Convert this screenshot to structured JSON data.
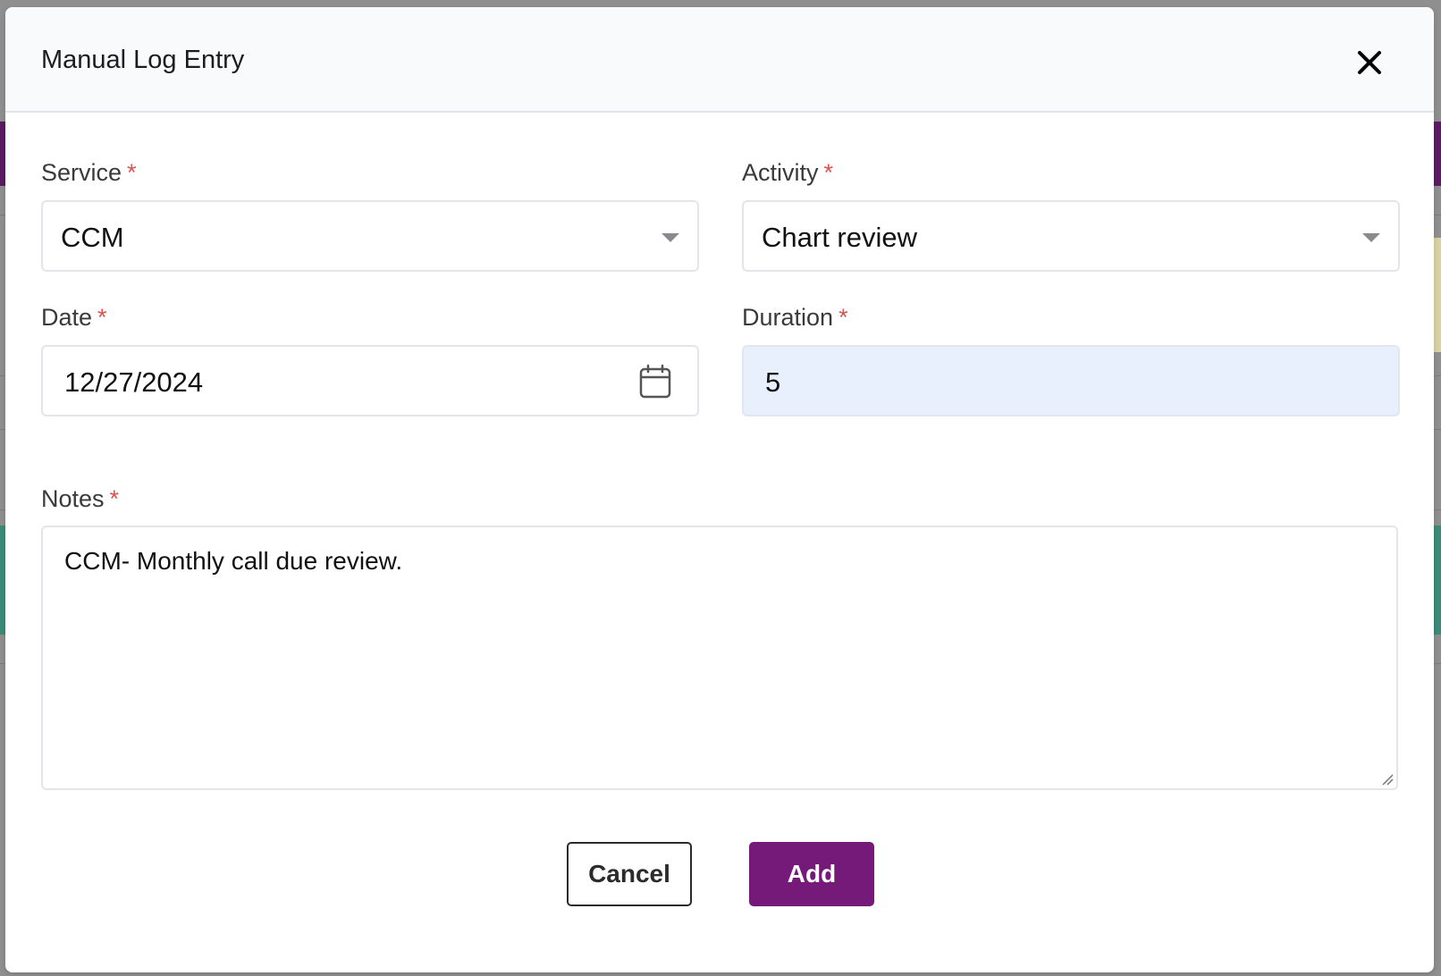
{
  "modal": {
    "title": "Manual Log Entry",
    "close_icon": "close-icon"
  },
  "form": {
    "service": {
      "label": "Service",
      "required_mark": "*",
      "value": "CCM"
    },
    "activity": {
      "label": "Activity",
      "required_mark": "*",
      "value": "Chart review"
    },
    "date": {
      "label": "Date",
      "required_mark": "*",
      "value": "12/27/2024",
      "icon": "calendar-icon"
    },
    "duration": {
      "label": "Duration",
      "required_mark": "*",
      "value": "5"
    },
    "notes": {
      "label": "Notes",
      "required_mark": "*",
      "value": "CCM- Monthly call due review."
    }
  },
  "actions": {
    "cancel_label": "Cancel",
    "add_label": "Add"
  },
  "colors": {
    "primary": "#751a78",
    "required": "#d9534f",
    "autofill": "#e9f0fd"
  }
}
